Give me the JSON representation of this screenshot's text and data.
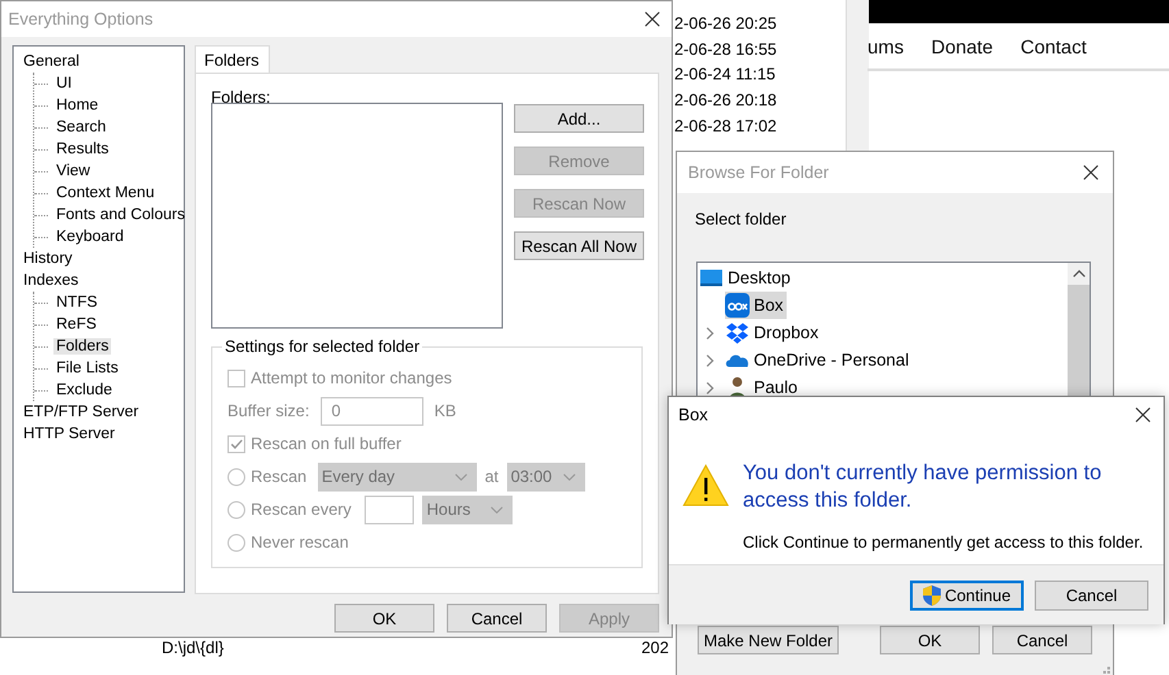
{
  "background": {
    "result_dates": [
      "2-06-26 20:25",
      "2-06-28 16:55",
      "2-06-24 11:15",
      "2-06-26 20:18",
      "2-06-28 17:02"
    ],
    "result_rows": [
      {
        "path": "D:\\jd\\{dl}",
        "date": "202"
      }
    ],
    "website_nav": [
      "ums",
      "Donate",
      "Contact"
    ]
  },
  "options_window": {
    "title": "Everything Options",
    "tree": [
      {
        "label": "General",
        "selected": false,
        "children": [
          {
            "label": "UI",
            "selected": false
          },
          {
            "label": "Home",
            "selected": false
          },
          {
            "label": "Search",
            "selected": false
          },
          {
            "label": "Results",
            "selected": false
          },
          {
            "label": "View",
            "selected": false
          },
          {
            "label": "Context Menu",
            "selected": false
          },
          {
            "label": "Fonts and Colours",
            "selected": false
          },
          {
            "label": "Keyboard",
            "selected": false
          }
        ]
      },
      {
        "label": "History",
        "selected": false
      },
      {
        "label": "Indexes",
        "selected": false,
        "children": [
          {
            "label": "NTFS",
            "selected": false
          },
          {
            "label": "ReFS",
            "selected": false
          },
          {
            "label": "Folders",
            "selected": true
          },
          {
            "label": "File Lists",
            "selected": false
          },
          {
            "label": "Exclude",
            "selected": false
          }
        ]
      },
      {
        "label": "ETP/FTP Server",
        "selected": false
      },
      {
        "label": "HTTP Server",
        "selected": false
      }
    ],
    "tabs": [
      {
        "label": "Folders",
        "selected": true
      }
    ],
    "folders_label": "Folders:",
    "side_buttons": [
      {
        "label": "Add...",
        "disabled": false
      },
      {
        "label": "Remove",
        "disabled": true
      },
      {
        "label": "Rescan Now",
        "disabled": true
      },
      {
        "label": "Rescan All Now",
        "disabled": false
      }
    ],
    "group": {
      "title": "Settings for selected folder",
      "disabled": true,
      "items": [
        {
          "kind": "checkbox",
          "label": "Attempt to monitor changes",
          "checked": false
        },
        {
          "kind": "field",
          "label": "Buffer size:",
          "value": "0",
          "unit": "KB"
        },
        {
          "kind": "checkbox",
          "label": "Rescan on full buffer",
          "checked": true
        },
        {
          "kind": "radio",
          "label": "Rescan",
          "selected": false,
          "dropdown": "Every day",
          "joiner": "at",
          "dropdown2": "03:00"
        },
        {
          "kind": "radio",
          "label": "Rescan every",
          "selected": false,
          "field": true,
          "dropdown": "Hours"
        },
        {
          "kind": "radio",
          "label": "Never rescan",
          "selected": false
        }
      ]
    },
    "footer_buttons": [
      {
        "label": "OK",
        "disabled": false
      },
      {
        "label": "Cancel",
        "disabled": false
      },
      {
        "label": "Apply",
        "disabled": true
      }
    ]
  },
  "browse_window": {
    "title": "Browse For Folder",
    "prompt": "Select folder",
    "tree": [
      {
        "label": "Desktop",
        "kind": "desktop",
        "selected": false,
        "expander": false
      },
      {
        "label": "Box",
        "kind": "box",
        "selected": true,
        "expander": false
      },
      {
        "label": "Dropbox",
        "kind": "dropbox",
        "selected": false,
        "expander": true
      },
      {
        "label": "OneDrive - Personal",
        "kind": "cloud",
        "selected": false,
        "expander": true
      },
      {
        "label": "Paulo",
        "kind": "user",
        "selected": false,
        "expander": true
      }
    ],
    "buttons": [
      "Make New Folder",
      "OK",
      "Cancel"
    ]
  },
  "box_dialog": {
    "title": "Box",
    "heading": "You don't currently have permission to access this folder.",
    "message": "Click Continue to permanently get access to this folder.",
    "buttons": [
      {
        "label": "Continue",
        "default": true,
        "shield": true
      },
      {
        "label": "Cancel",
        "default": false,
        "shield": false
      }
    ]
  }
}
